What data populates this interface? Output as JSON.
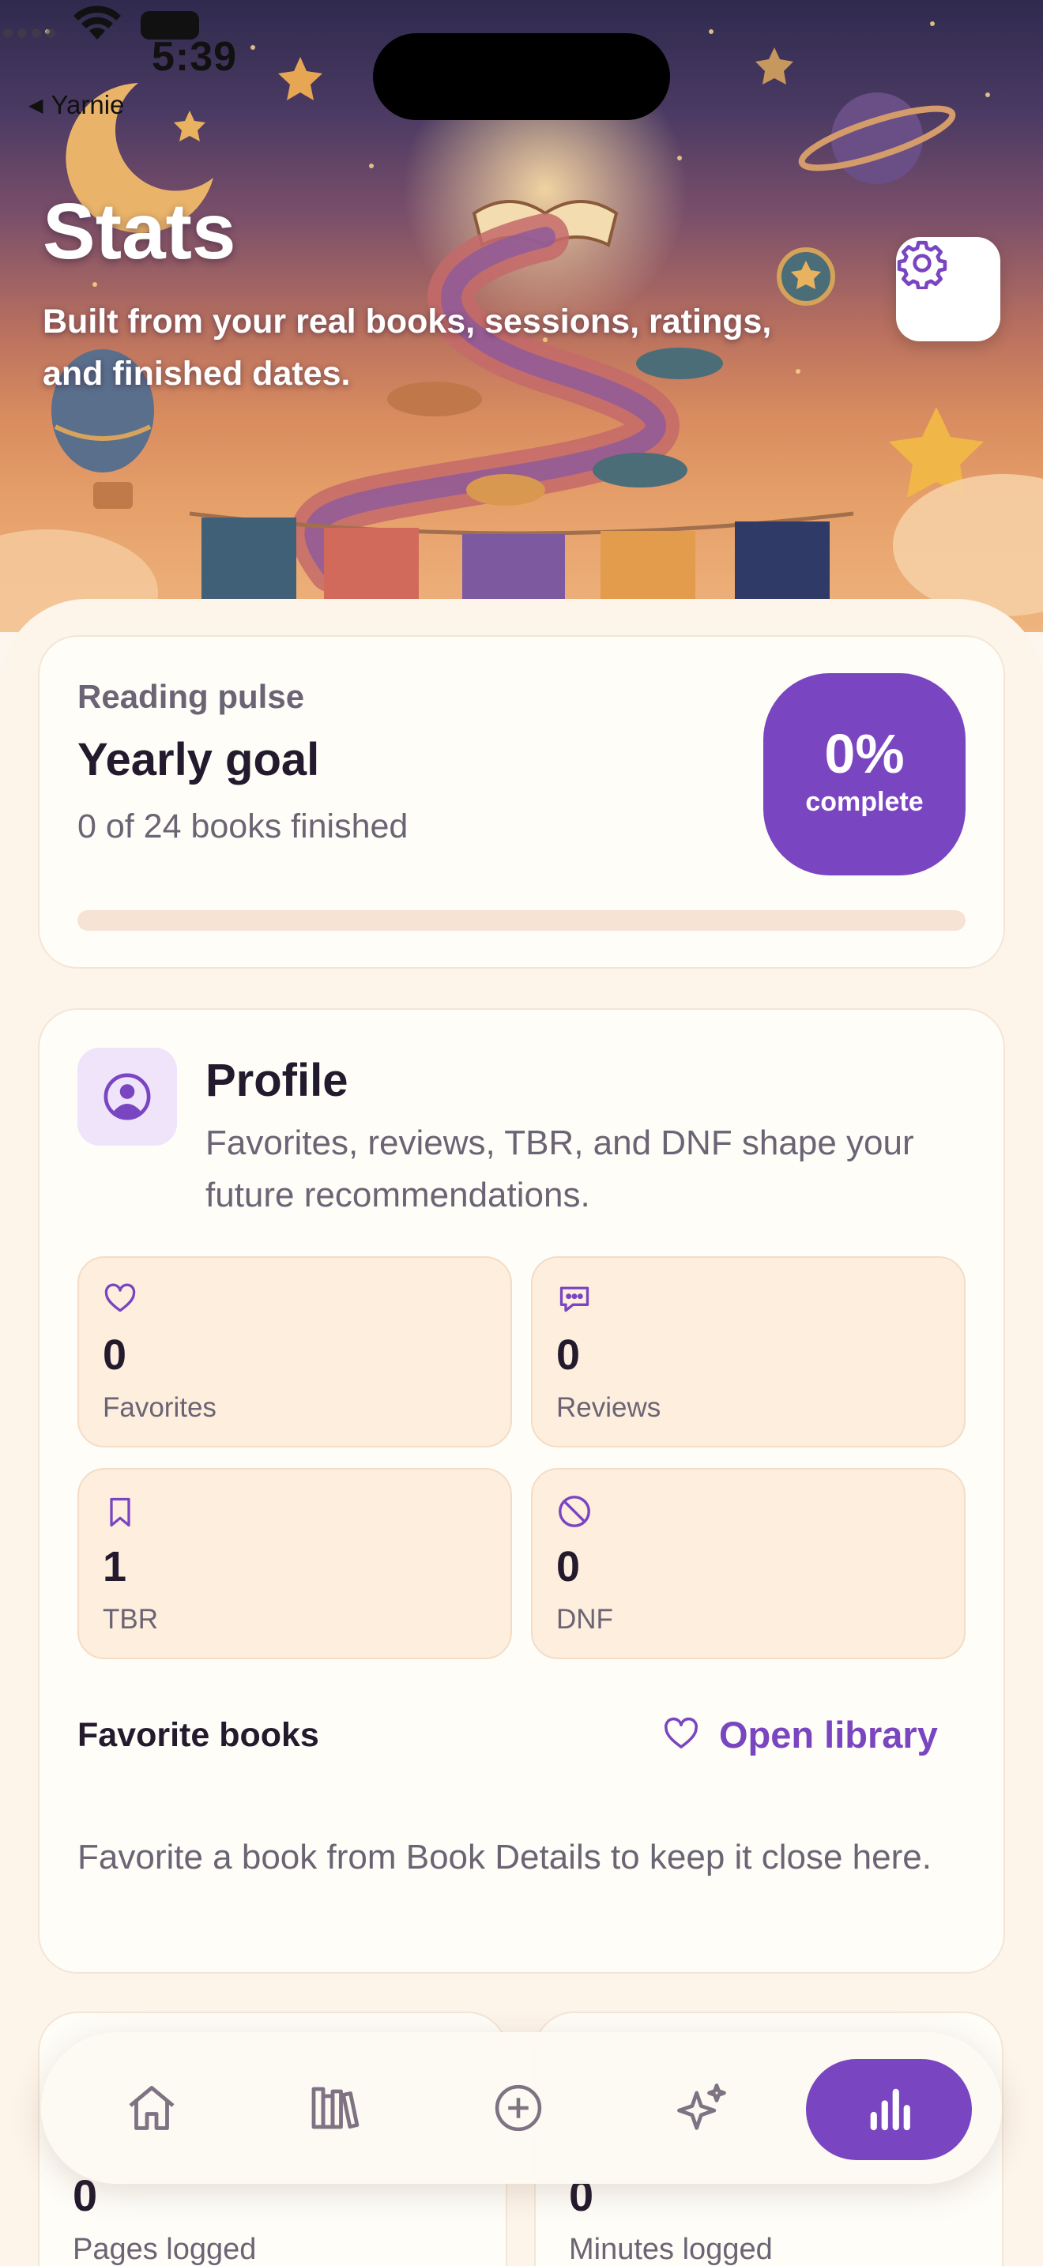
{
  "status_bar": {
    "time": "5:39",
    "back_app": "Yarnie"
  },
  "header": {
    "title": "Stats",
    "subtitle": "Built from your real books, sessions, ratings, and finished dates."
  },
  "goal_card": {
    "eyebrow": "Reading pulse",
    "title": "Yearly goal",
    "progress_text": "0 of 24 books finished",
    "percent_value": "0%",
    "percent_label": "complete",
    "progress_fraction": 0
  },
  "profile_card": {
    "title": "Profile",
    "subtitle": "Favorites, reviews, TBR, and DNF shape your future recommendations.",
    "stats": [
      {
        "icon": "heart-icon",
        "value": "0",
        "label": "Favorites"
      },
      {
        "icon": "chat-bubble-icon",
        "value": "0",
        "label": "Reviews"
      },
      {
        "icon": "bookmark-icon",
        "value": "1",
        "label": "TBR"
      },
      {
        "icon": "prohibited-icon",
        "value": "0",
        "label": "DNF"
      }
    ],
    "favorites_heading": "Favorite books",
    "open_library_label": "Open library",
    "favorites_empty": "Favorite a book from Book Details to keep it close here."
  },
  "summary_cards": [
    {
      "value": "0",
      "label": "Pages logged"
    },
    {
      "value": "0",
      "label": "Minutes logged"
    }
  ],
  "tab_bar": {
    "tabs": [
      "home-icon",
      "library-icon",
      "add-icon",
      "sparkles-icon",
      "stats-icon"
    ],
    "active": "stats-icon"
  },
  "colors": {
    "accent": "#7a45c0",
    "tile_bg": "#fdeedd",
    "sheet_bg": "#fdf4ea",
    "muted_text": "#6b6474"
  }
}
